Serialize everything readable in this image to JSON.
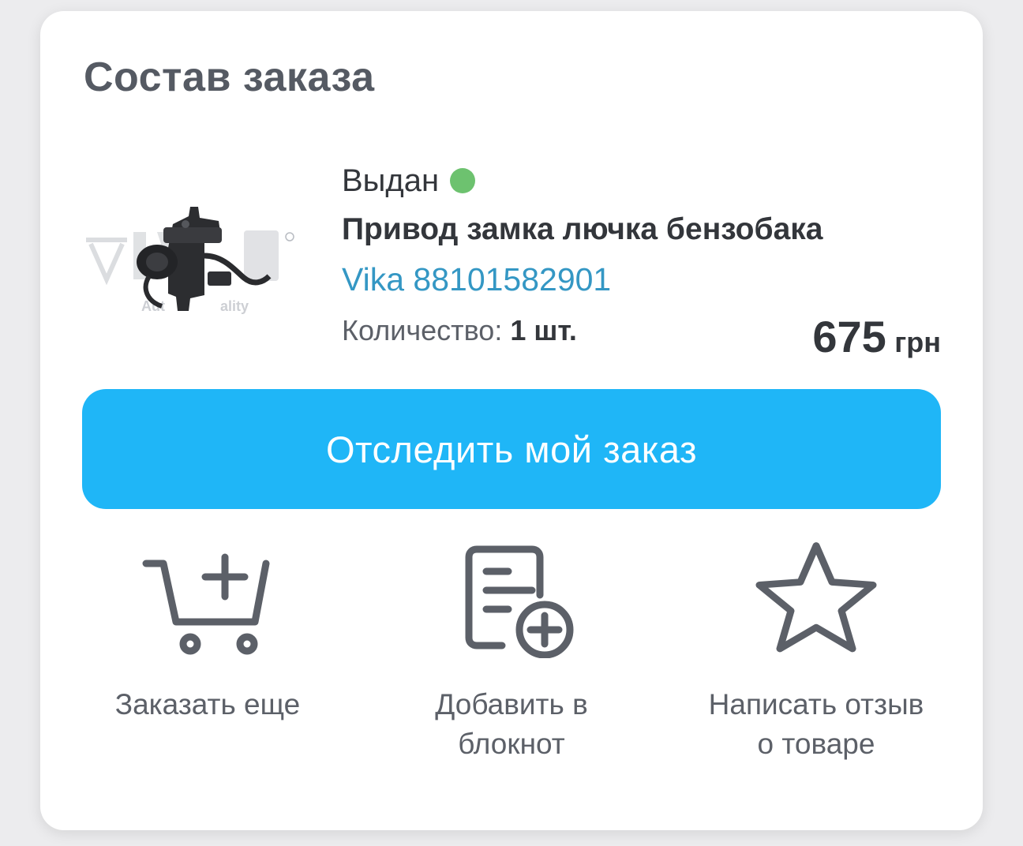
{
  "order": {
    "title": "Состав заказа",
    "item": {
      "status": "Выдан",
      "status_color": "#6dc26f",
      "name": "Привод замка лючка бензобака",
      "sku": "Vika 88101582901",
      "quantity_label": "Количество:",
      "quantity_value": "1 шт.",
      "price_amount": "675",
      "price_currency": "грн",
      "image_watermark": "Auto Quality"
    },
    "track_button_label": "Отследить мой заказ",
    "actions": [
      {
        "label": "Заказать еще",
        "icon": "cart-plus-icon"
      },
      {
        "label": "Добавить в блокнот",
        "icon": "document-plus-icon"
      },
      {
        "label": "Написать отзыв о товаре",
        "icon": "star-outline-icon"
      }
    ]
  },
  "colors": {
    "accent": "#1fb6f7",
    "sku_link": "#3497c4",
    "icon": "#5c6068"
  }
}
